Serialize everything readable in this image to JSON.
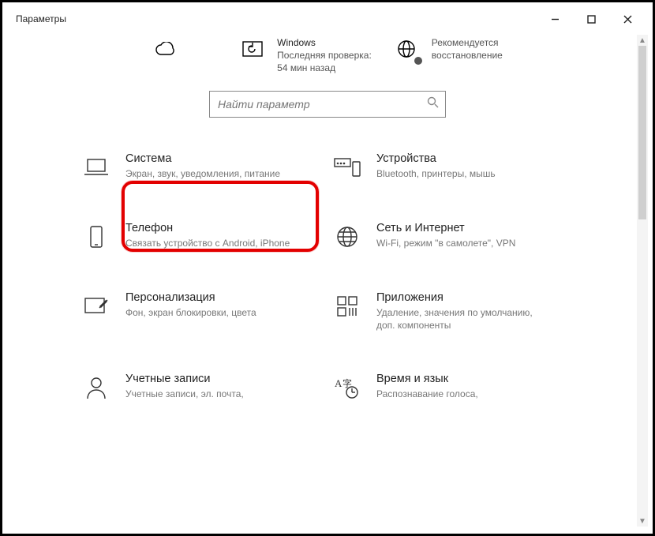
{
  "window": {
    "title": "Параметры"
  },
  "strip": {
    "onedrive": {
      "icon": "cloud-icon"
    },
    "update": {
      "icon": "refresh-icon",
      "title": "Windows",
      "line1": "Последняя проверка:",
      "line2": "54 мин назад"
    },
    "web": {
      "icon": "globe-icon",
      "line1": "Рекомендуется",
      "line2": "восстановление"
    }
  },
  "search": {
    "placeholder": "Найти параметр"
  },
  "tiles": {
    "system": {
      "title": "Система",
      "desc": "Экран, звук, уведомления, питание"
    },
    "devices": {
      "title": "Устройства",
      "desc": "Bluetooth, принтеры, мышь"
    },
    "phone": {
      "title": "Телефон",
      "desc": "Связать устройство с Android, iPhone"
    },
    "network": {
      "title": "Сеть и Интернет",
      "desc": "Wi-Fi, режим \"в самолете\", VPN"
    },
    "personal": {
      "title": "Персонализация",
      "desc": "Фон, экран блокировки, цвета"
    },
    "apps": {
      "title": "Приложения",
      "desc": "Удаление, значения по умолчанию, доп. компоненты"
    },
    "accounts": {
      "title": "Учетные записи",
      "desc": "Учетные записи, эл. почта,"
    },
    "time": {
      "title": "Время и язык",
      "desc": "Распознавание голоса,"
    }
  }
}
